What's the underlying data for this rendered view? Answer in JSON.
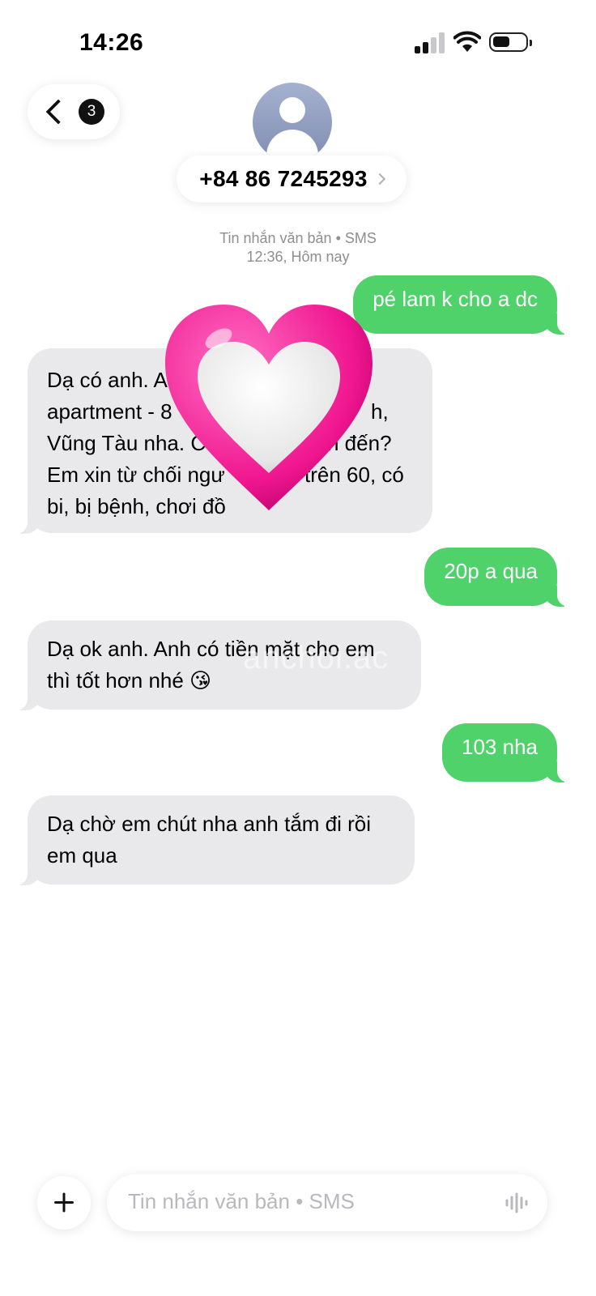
{
  "status_bar": {
    "time": "14:26"
  },
  "header": {
    "back_count": "3",
    "contact": "+84 86 7245293"
  },
  "meta": {
    "service": "Tin nhắn văn bản • SMS",
    "timestamp": "12:36, Hôm nay"
  },
  "messages": [
    {
      "direction": "sent",
      "text": "pé lam k cho a dc"
    },
    {
      "direction": "received",
      "lines": [
        "Dạ có anh. A",
        "apartment - 8",
        "Vũng Tàu nha. C",
        "Em xin từ chối ngư",
        "bi, bị bệnh, chơi đồ"
      ],
      "right_fragments": [
        "h,",
        "n đến?",
        "trên 60, có"
      ]
    },
    {
      "direction": "sent",
      "text": "20p a qua"
    },
    {
      "direction": "received",
      "lines": [
        "Dạ ok anh. Anh có tiền mặt cho em",
        "thì tốt hơn nhé 😘"
      ]
    },
    {
      "direction": "sent",
      "text": "103 nha"
    },
    {
      "direction": "received",
      "lines": [
        "Dạ chờ em chút nha anh tắm đi rồi",
        "em qua"
      ]
    }
  ],
  "watermark": "anchoi.ac",
  "input": {
    "placeholder": "Tin nhắn văn bản • SMS"
  },
  "icons": [
    "back-chevron-icon",
    "avatar-icon",
    "plus-icon",
    "waveform-icon",
    "heart-sticker"
  ],
  "colors": {
    "sent_bubble": "#4fd26a",
    "received_bubble": "#e9e9eb",
    "meta_text": "#8e8e93"
  }
}
